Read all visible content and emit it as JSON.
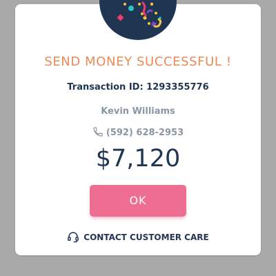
{
  "dialog": {
    "title": "SEND MONEY SUCCESSFUL !",
    "transaction_id": "Transaction ID: 1293355776",
    "recipient_name": "Kevin Williams",
    "recipient_phone": "(592) 628-2953",
    "amount": "$7,120",
    "ok_label": "OK",
    "contact_label": "CONTACT CUSTOMER CARE"
  },
  "icons": {
    "badge": "celebration-confetti-icon",
    "phone": "phone-icon",
    "contact": "headset-icon"
  },
  "colors": {
    "backdrop": "#a9a9a9",
    "card": "#ffffff",
    "badge": "#1f3552",
    "title": "#ec8a57",
    "dark_text": "#1f3552",
    "muted_text": "#8a96a6",
    "button": "#ee6e91"
  }
}
